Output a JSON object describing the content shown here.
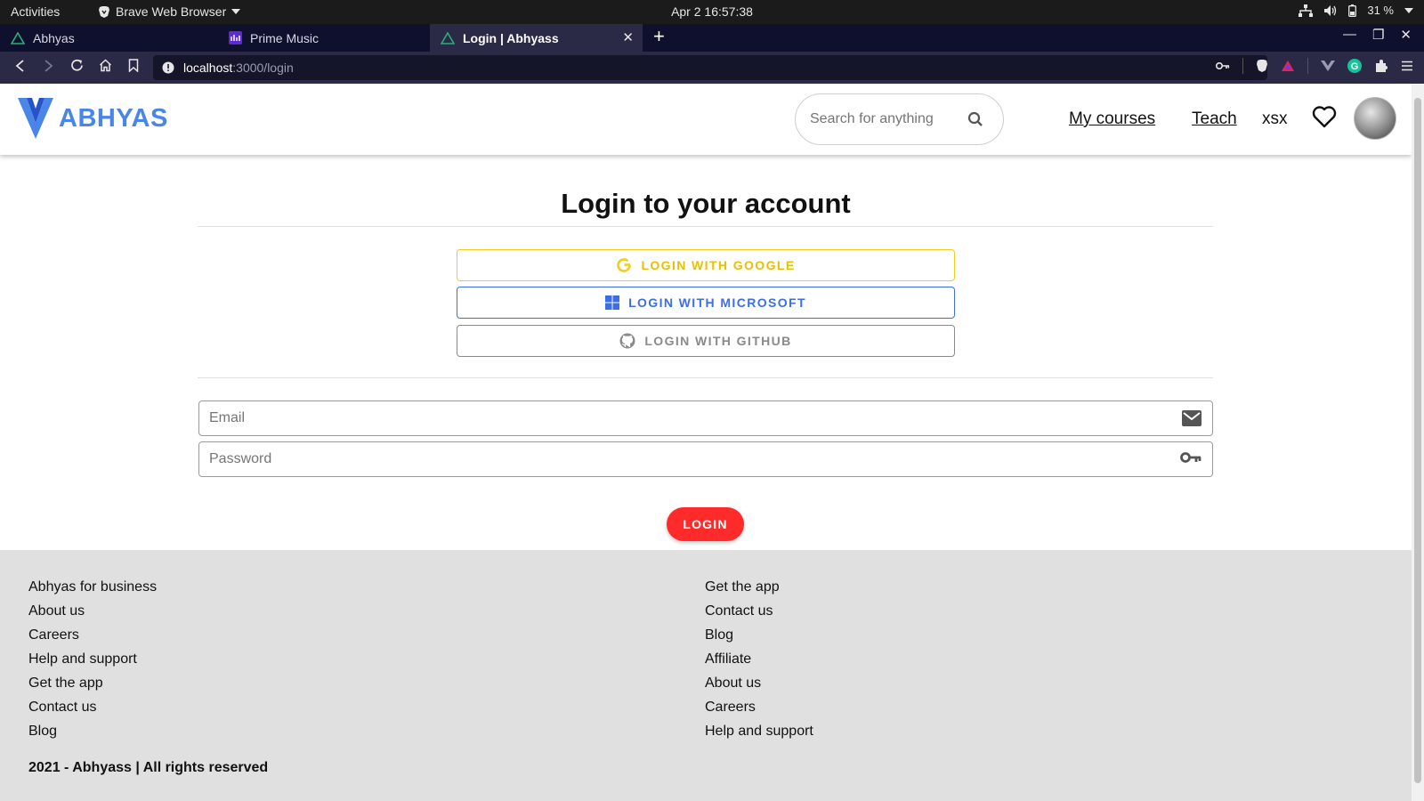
{
  "system_bar": {
    "activities": "Activities",
    "app_name": "Brave Web Browser",
    "clock": "Apr 2  16:57:38",
    "battery": "31 %"
  },
  "tabs": [
    {
      "label": "Abhyas"
    },
    {
      "label": "Prime Music"
    },
    {
      "label": "Login | Abhyass",
      "active": true
    }
  ],
  "address_bar": {
    "host": "localhost",
    "path": ":3000/login"
  },
  "site": {
    "logo_text": "ABHYAS",
    "search_placeholder": "Search for anything",
    "nav": {
      "my_courses": "My courses",
      "teach": "Teach",
      "username": "xsx"
    }
  },
  "login": {
    "title": "Login to your account",
    "google_label": "LOGIN WITH GOOGLE",
    "microsoft_label": "LOGIN WITH MICROSOFT",
    "github_label": "LOGIN WITH GITHUB",
    "email_placeholder": "Email",
    "password_placeholder": "Password",
    "submit_label": "LOGIN"
  },
  "footer": {
    "col1": [
      "Abhyas for business",
      "About us",
      "Careers",
      "Help and support",
      "Get the app",
      "Contact us",
      "Blog"
    ],
    "col2": [
      "Get the app",
      "Contact us",
      "Blog",
      "Affiliate",
      "About us",
      "Careers",
      "Help and support"
    ],
    "copyright": "2021 - Abhyass | All rights reserved"
  },
  "colors": {
    "brand": "#4a86e8",
    "google": "#f4cc1a",
    "microsoft": "#3b6ee8",
    "login_button": "#ff2a2a"
  }
}
